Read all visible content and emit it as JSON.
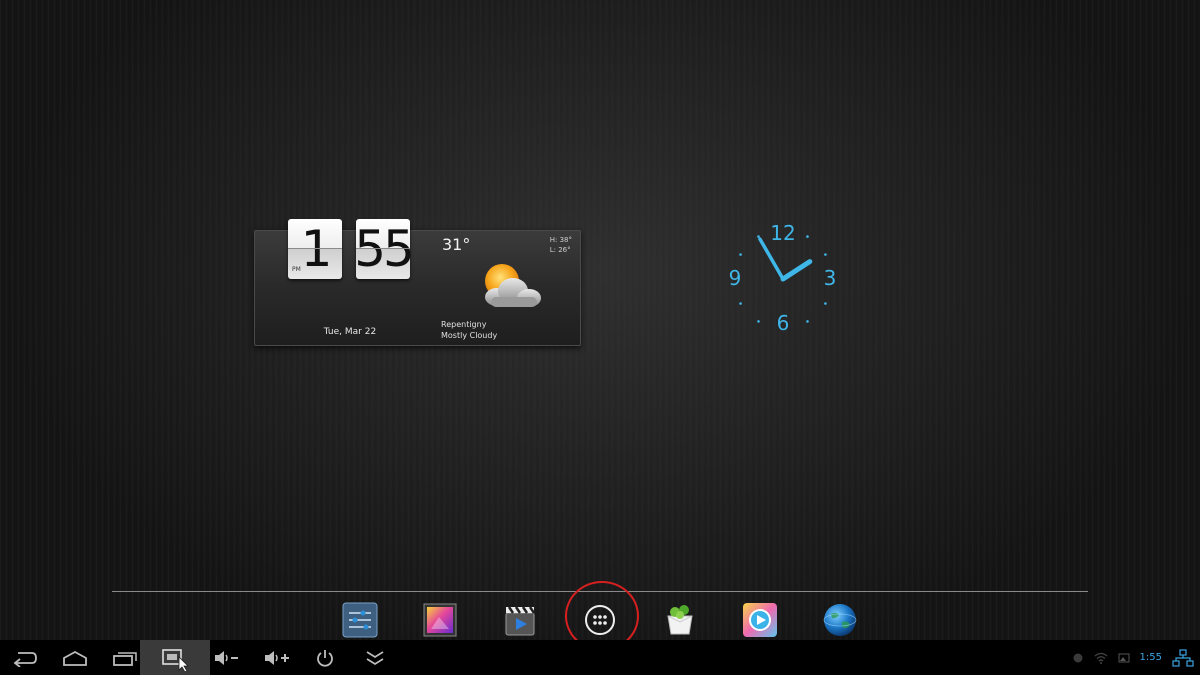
{
  "widget": {
    "hour": "1",
    "minute": "55",
    "ampm": "PM",
    "date": "Tue, Mar 22",
    "temperature": "31°",
    "high": "H: 38°",
    "low": "L: 26°",
    "location": "Repentigny",
    "condition": "Mostly Cloudy",
    "weather_icon": "partly-cloudy-icon"
  },
  "analog_clock": {
    "numerals": [
      "12",
      "3",
      "6",
      "9"
    ],
    "hour_value": 1.9,
    "minute_value": 55,
    "color": "#3fb6e8"
  },
  "dock": {
    "items": [
      "settings-icon",
      "gallery-icon",
      "video-player-icon",
      "app-drawer-icon",
      "market-icon",
      "media-player-icon",
      "browser-icon"
    ],
    "highlight_color": "#d62020"
  },
  "system_bar": {
    "buttons": [
      "back-icon",
      "home-icon",
      "recent-apps-icon",
      "screenshot-icon",
      "volume-down-icon",
      "volume-up-icon",
      "power-icon",
      "expand-icon"
    ],
    "status_time": "1:55",
    "status_icons": [
      "notification-dot-icon",
      "wifi-icon",
      "image-notification-icon",
      "ethernet-icon"
    ],
    "accent": "#3ba4e0"
  }
}
